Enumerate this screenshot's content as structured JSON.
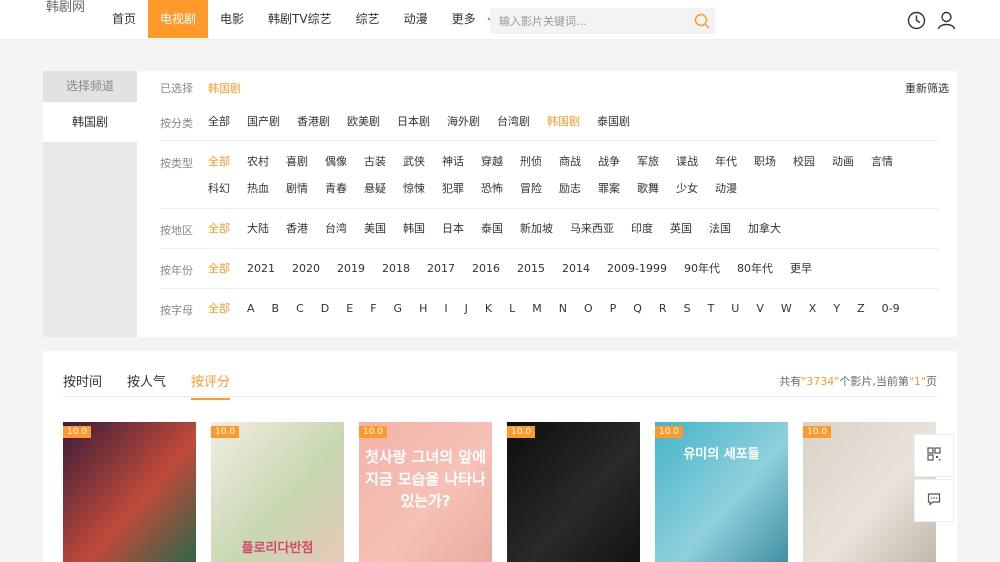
{
  "site": {
    "logo": "韩剧网"
  },
  "nav": {
    "items": [
      {
        "label": "首页"
      },
      {
        "label": "电视剧",
        "active": true
      },
      {
        "label": "电影"
      },
      {
        "label": "韩剧TV综艺"
      },
      {
        "label": "综艺"
      },
      {
        "label": "动漫"
      },
      {
        "label": "更多"
      }
    ]
  },
  "search": {
    "placeholder": "输入影片关键词..."
  },
  "channel": {
    "header": "选择频道",
    "selected_channel": "韩国剧"
  },
  "filters": {
    "selected": {
      "label": "已选择",
      "value": "韩国剧"
    },
    "reset_label": "重新筛选",
    "category": {
      "label": "按分类",
      "options": [
        "全部",
        "国产剧",
        "香港剧",
        "欧美剧",
        "日本剧",
        "海外剧",
        "台湾剧",
        "韩国剧",
        "泰国剧"
      ],
      "selected": "韩国剧"
    },
    "type": {
      "label": "按类型",
      "options": [
        "全部",
        "农村",
        "喜剧",
        "偶像",
        "古装",
        "武侠",
        "神话",
        "穿越",
        "刑侦",
        "商战",
        "战争",
        "军旅",
        "谍战",
        "年代",
        "职场",
        "校园",
        "动画",
        "言情",
        "科幻",
        "热血",
        "剧情",
        "青春",
        "悬疑",
        "惊悚",
        "犯罪",
        "恐怖",
        "冒险",
        "励志",
        "罪案",
        "歌舞",
        "少女",
        "动漫"
      ],
      "selected": "全部"
    },
    "region": {
      "label": "按地区",
      "options": [
        "全部",
        "大陆",
        "香港",
        "台湾",
        "美国",
        "韩国",
        "日本",
        "泰国",
        "新加坡",
        "马来西亚",
        "印度",
        "英国",
        "法国",
        "加拿大"
      ],
      "selected": "全部"
    },
    "year": {
      "label": "按年份",
      "options": [
        "全部",
        "2021",
        "2020",
        "2019",
        "2018",
        "2017",
        "2016",
        "2015",
        "2014",
        "2009-1999",
        "90年代",
        "80年代",
        "更早"
      ],
      "selected": "全部"
    },
    "letter": {
      "label": "按字母",
      "options": [
        "全部",
        "A",
        "B",
        "C",
        "D",
        "E",
        "F",
        "G",
        "H",
        "I",
        "J",
        "K",
        "L",
        "M",
        "N",
        "O",
        "P",
        "Q",
        "R",
        "S",
        "T",
        "U",
        "V",
        "W",
        "X",
        "Y",
        "Z",
        "0-9"
      ],
      "selected": "全部"
    }
  },
  "sort": {
    "tabs": [
      {
        "label": "按时间"
      },
      {
        "label": "按人气"
      },
      {
        "label": "按评分",
        "active": true
      }
    ]
  },
  "summary": {
    "prefix": "共有",
    "total": "\"3734\"",
    "middle": "个影片,当前第",
    "page": "\"1\"",
    "suffix": "页"
  },
  "posters": [
    {
      "score": "10.0",
      "poster_text": "",
      "colors": [
        "#3a1d3a",
        "#c04a3a",
        "#1f6a4a"
      ]
    },
    {
      "score": "10.0",
      "poster_text": "플로리다반점",
      "colors": [
        "#f2ede3",
        "#c7d7b0",
        "#e8c9b8"
      ]
    },
    {
      "score": "10.0",
      "poster_text": "첫사랑 그녀의 앞에 지금 모습을 나타나있는가?",
      "colors": [
        "#f2b3a8",
        "#f6c1b6",
        "#e8a9a0"
      ]
    },
    {
      "score": "10.0",
      "poster_text": "",
      "colors": [
        "#0d0d0d",
        "#2a2a2a",
        "#111111"
      ]
    },
    {
      "score": "10.0",
      "poster_text": "유미의 세포들",
      "colors": [
        "#44b4c9",
        "#8fd0dc",
        "#3a8aa0"
      ]
    },
    {
      "score": "10.0",
      "poster_text": "",
      "colors": [
        "#d9d2c7",
        "#e9e3da",
        "#bfb4a6"
      ]
    }
  ],
  "icons": {
    "history": "clock-icon",
    "user": "user-icon",
    "search": "search-icon",
    "qr": "qr-code-icon",
    "feedback": "message-icon"
  },
  "colors": {
    "accent": "#ff9a2a"
  }
}
